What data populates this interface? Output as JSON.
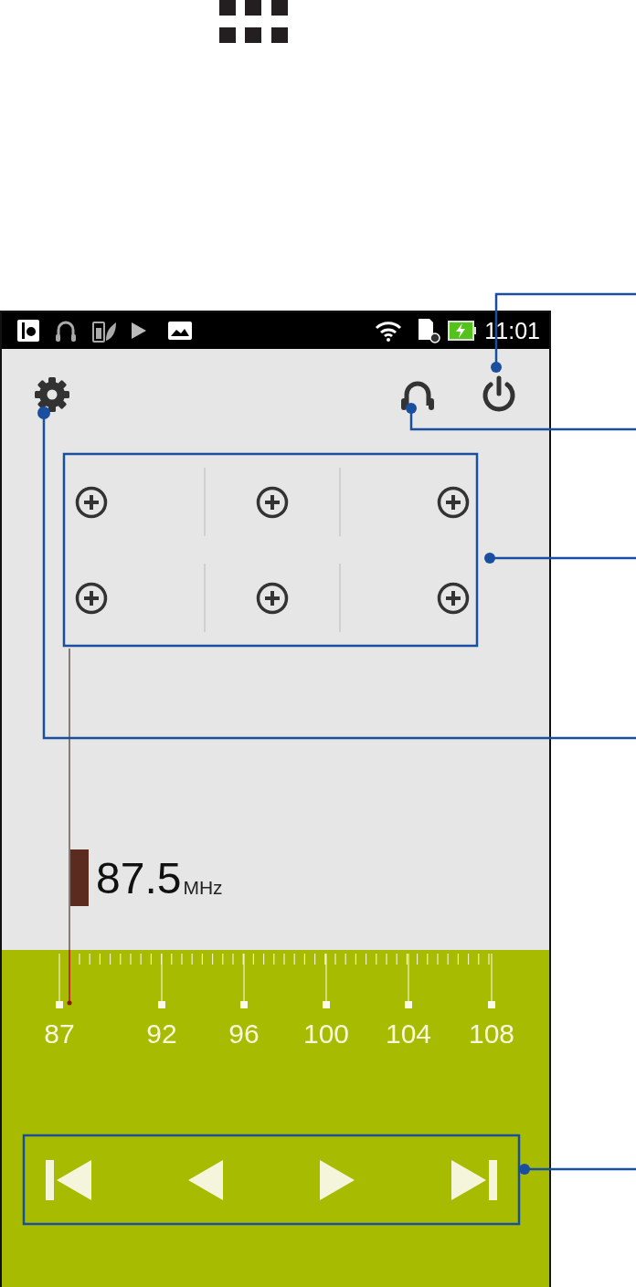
{
  "status_bar": {
    "time": "11:01"
  },
  "frequency": {
    "value": "87.5",
    "unit": "MHz"
  },
  "tuner": {
    "scale_labels": [
      "87",
      "92",
      "96",
      "100",
      "104",
      "108"
    ]
  }
}
